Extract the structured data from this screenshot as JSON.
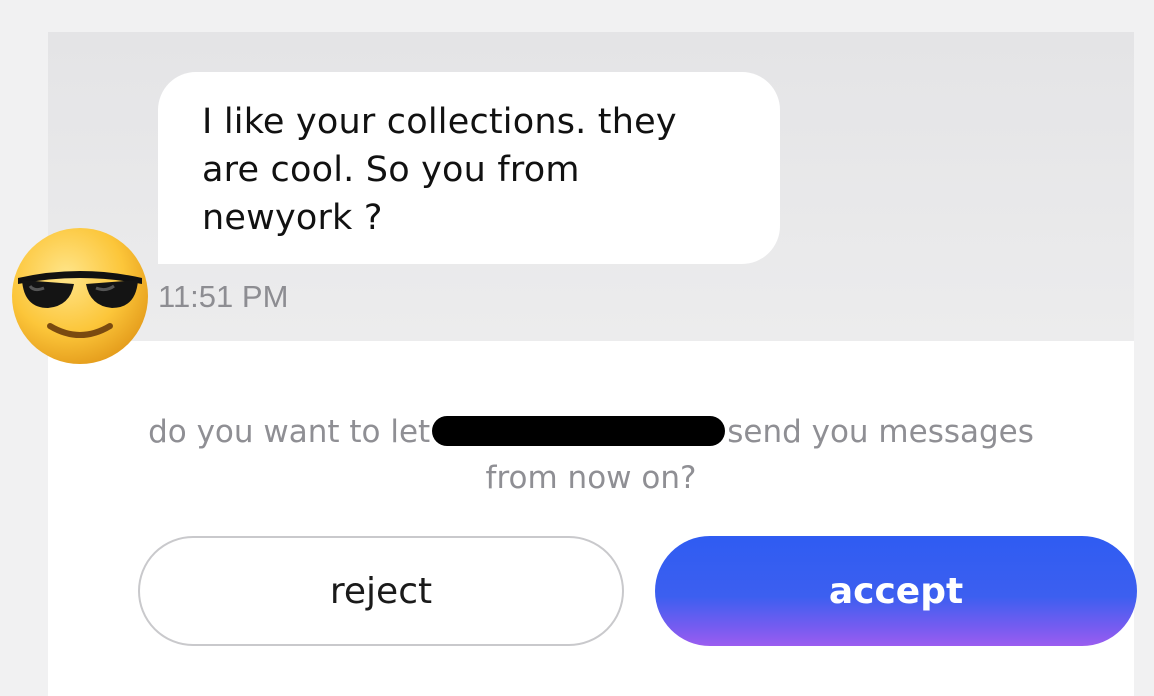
{
  "message": {
    "lines": [
      "I like your collections. they",
      "are cool. So you from",
      "newyork ?"
    ],
    "time": "11:51 PM"
  },
  "sender": {
    "avatar_icon": "smiling-face-with-sunglasses-emoji"
  },
  "request": {
    "text_before": "do you want to let",
    "text_after": "send you messages",
    "text_line2": "from now on?"
  },
  "actions": {
    "reject_label": "reject",
    "accept_label": "accept"
  },
  "colors": {
    "accent_start": "#2f5cf2",
    "accent_end": "#9b5df0"
  }
}
